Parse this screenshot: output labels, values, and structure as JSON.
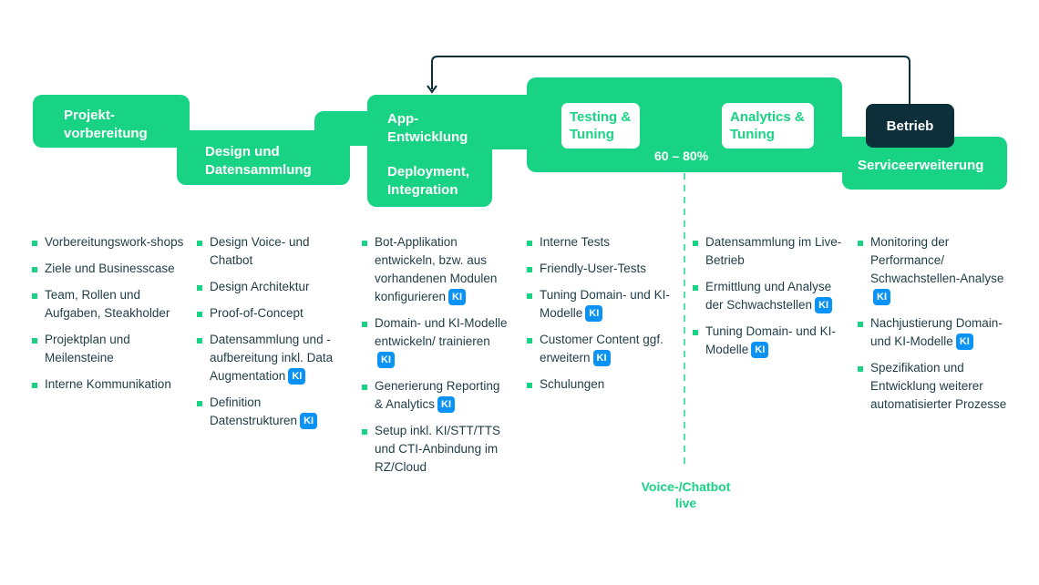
{
  "colors": {
    "green": "#19d385",
    "dark": "#0d2f3a",
    "text": "#1f3d47",
    "ki_badge": "#0a93f5"
  },
  "phases": {
    "projektvorbereitung": [
      "Projekt-",
      "vorbereitung"
    ],
    "design": [
      "Design und",
      "Datensammlung"
    ],
    "app": [
      "App-",
      "Entwicklung"
    ],
    "deployment": [
      "Deployment,",
      "Integration"
    ],
    "testing": [
      "Testing &",
      "Tuning"
    ],
    "analytics": [
      "Analytics &",
      "Tuning"
    ],
    "percent": "60 – 80%",
    "betrieb": "Betrieb",
    "service": "Serviceerweiterung"
  },
  "milestone": {
    "label_line1": "Voice-/Chatbot",
    "label_line2": "live"
  },
  "badge_label": "KI",
  "columns": [
    {
      "items": [
        {
          "text": "Vorbereitungswork-shops",
          "ki": false
        },
        {
          "text": "Ziele und Businesscase",
          "ki": false
        },
        {
          "text": "Team, Rollen und Aufgaben, Steakholder",
          "ki": false
        },
        {
          "text": "Projektplan und Meilensteine",
          "ki": false
        },
        {
          "text": "Interne Kommunikation",
          "ki": false
        }
      ]
    },
    {
      "items": [
        {
          "text": "Design Voice- und Chatbot",
          "ki": false
        },
        {
          "text": "Design Architektur",
          "ki": false
        },
        {
          "text": "Proof-of-Concept",
          "ki": false
        },
        {
          "text": "Datensammlung und -aufbereitung inkl. Data Augmentation",
          "ki": true
        },
        {
          "text": "Definition Datenstrukturen",
          "ki": true
        }
      ]
    },
    {
      "items": [
        {
          "text": "Bot-Applikation entwickeln, bzw. aus vorhandenen Modulen konfigurieren",
          "ki": true
        },
        {
          "text": "Domain- und KI-Modelle entwickeln/ trainieren",
          "ki": true
        },
        {
          "text": "Generierung Reporting & Analytics",
          "ki": true
        },
        {
          "text": "Setup inkl. KI/STT/TTS und CTI-Anbindung im RZ/Cloud",
          "ki": false
        }
      ]
    },
    {
      "items": [
        {
          "text": "Interne Tests",
          "ki": false
        },
        {
          "text": "Friendly-User-Tests",
          "ki": false
        },
        {
          "text": "Tuning Domain- und KI-Modelle",
          "ki": true
        },
        {
          "text": "Customer Content ggf. erweitern",
          "ki": true
        },
        {
          "text": "Schulungen",
          "ki": false
        }
      ]
    },
    {
      "items": [
        {
          "text": "Datensammlung im Live-Betrieb",
          "ki": false
        },
        {
          "text": "Ermittlung und Analyse der Schwachstellen",
          "ki": true
        },
        {
          "text": "Tuning Domain- und KI-Modelle",
          "ki": true
        }
      ]
    },
    {
      "items": [
        {
          "text": "Monitoring der Performance/ Schwachstellen-Analyse",
          "ki": true
        },
        {
          "text": "Nachjustierung Domain- und KI-Modelle",
          "ki": true
        },
        {
          "text": "Spezifikation und Entwicklung weiterer automatisierter Prozesse",
          "ki": false
        }
      ]
    }
  ]
}
